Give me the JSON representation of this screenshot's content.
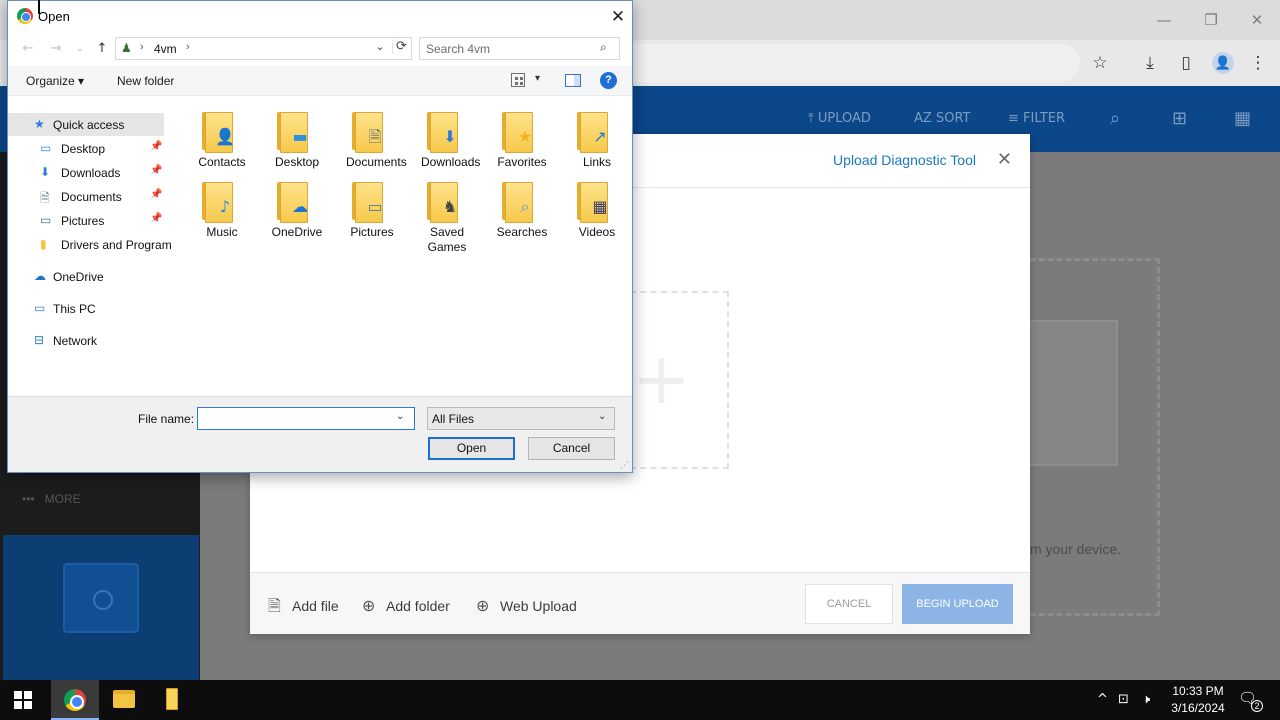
{
  "browser": {
    "window_controls": {
      "minimize": "—",
      "maximize": "❐",
      "close": "✕"
    },
    "toolbar_icons": [
      "star-icon",
      "download-icon",
      "sidepanel-icon",
      "profile-icon",
      "menu-icon"
    ],
    "toolbar_glyphs": {
      "star": "☆",
      "download": "⤓",
      "sidepanel": "▯",
      "menu": "⋮",
      "avatar": "👤"
    }
  },
  "app": {
    "header_actions": [
      {
        "icon": "⤒",
        "label": "UPLOAD"
      },
      {
        "icon": "AZ",
        "label": "SORT"
      },
      {
        "icon": "≡",
        "label": "FILTER"
      },
      {
        "icon": "⌕",
        "label": ""
      },
      {
        "icon": "⊞",
        "label": ""
      },
      {
        "icon": "▦",
        "label": ""
      }
    ],
    "sidebar_more": "MORE",
    "sidebar_more_icon": "•••",
    "bg_device_text": "m your device."
  },
  "upload_modal": {
    "title": "Upload Diagnostic Tool",
    "close": "✕",
    "plus": "+",
    "actions": [
      {
        "icon": "🗎",
        "label": "Add file"
      },
      {
        "icon": "⊕",
        "label": "Add folder"
      },
      {
        "icon": "⊕",
        "label": "Web Upload"
      }
    ],
    "cancel_label": "CANCEL",
    "begin_label": "BEGIN UPLOAD"
  },
  "open_dialog": {
    "title": "Open",
    "close": "✕",
    "nav": {
      "back": "←",
      "forward": "→",
      "recent": "⌄",
      "up": "↑"
    },
    "breadcrumb": {
      "sep": "›",
      "folder": "4vm",
      "dropdown": "⌄",
      "refresh": "⟳"
    },
    "search_placeholder": "Search 4vm",
    "search_icon": "⌕",
    "commands": {
      "organize": "Organize ▾",
      "new_folder": "New folder",
      "view_dropdown": "▾",
      "help": "?"
    },
    "nav_pane": [
      {
        "label": "Quick access",
        "icon": "★",
        "color": "#2f7ad9",
        "pinned": false,
        "selected": true,
        "indent": 1
      },
      {
        "label": "Desktop",
        "icon": "▭",
        "color": "#2d8fe2",
        "pinned": true,
        "selected": false,
        "indent": 2
      },
      {
        "label": "Downloads",
        "icon": "⬇",
        "color": "#2f7ad9",
        "pinned": true,
        "selected": false,
        "indent": 2
      },
      {
        "label": "Documents",
        "icon": "🗎",
        "color": "#6a7a8a",
        "pinned": true,
        "selected": false,
        "indent": 2
      },
      {
        "label": "Pictures",
        "icon": "▭",
        "color": "#4f6f8f",
        "pinned": true,
        "selected": false,
        "indent": 2
      },
      {
        "label": "Drivers and Program",
        "icon": "▮",
        "color": "#f3c443",
        "pinned": false,
        "selected": false,
        "indent": 2
      },
      {
        "label": "OneDrive",
        "icon": "☁",
        "color": "#1e74d4",
        "pinned": false,
        "selected": false,
        "indent": 1
      },
      {
        "label": "This PC",
        "icon": "▭",
        "color": "#3b7fc9",
        "pinned": false,
        "selected": false,
        "indent": 1
      },
      {
        "label": "Network",
        "icon": "⊟",
        "color": "#3b7fc9",
        "pinned": false,
        "selected": false,
        "indent": 1
      }
    ],
    "pin_glyph": "📌",
    "files": [
      {
        "name": "Contacts",
        "badge": "👤",
        "badge_color": "#3f6fb0"
      },
      {
        "name": "Desktop",
        "badge": "▬",
        "badge_color": "#2d8fe2"
      },
      {
        "name": "Documents",
        "badge": "🗎",
        "badge_color": "#5b6b7c"
      },
      {
        "name": "Downloads",
        "badge": "⬇",
        "badge_color": "#2f7ad9"
      },
      {
        "name": "Favorites",
        "badge": "★",
        "badge_color": "#f0b41a"
      },
      {
        "name": "Links",
        "badge": "↗",
        "badge_color": "#1f76d6"
      },
      {
        "name": "Music",
        "badge": "♪",
        "badge_color": "#1f8be0"
      },
      {
        "name": "OneDrive",
        "badge": "☁",
        "badge_color": "#1e74d4"
      },
      {
        "name": "Pictures",
        "badge": "▭",
        "badge_color": "#4d7aa6"
      },
      {
        "name": "Saved Games",
        "badge": "♞",
        "badge_color": "#444444"
      },
      {
        "name": "Searches",
        "badge": "⌕",
        "badge_color": "#5b93c9"
      },
      {
        "name": "Videos",
        "badge": "▦",
        "badge_color": "#3a3a6a"
      }
    ],
    "file_name_label": "File name:",
    "file_name_value": "",
    "file_name_dropdown": "⌄",
    "file_type": "All Files",
    "file_type_dropdown": "⌄",
    "open_label": "Open",
    "cancel_label": "Cancel",
    "resize_grip": "⋰"
  },
  "taskbar": {
    "tray_icons": {
      "chevron": "^",
      "network": "⊡",
      "volume": "🕨"
    },
    "time": "10:33 PM",
    "date": "3/16/2024",
    "notification_icon": "🗨",
    "notification_count": "2"
  },
  "colors": {
    "accent": "#1a78c2",
    "header_bg": "#0b4789",
    "begin_upload": "#8cb5e6"
  }
}
